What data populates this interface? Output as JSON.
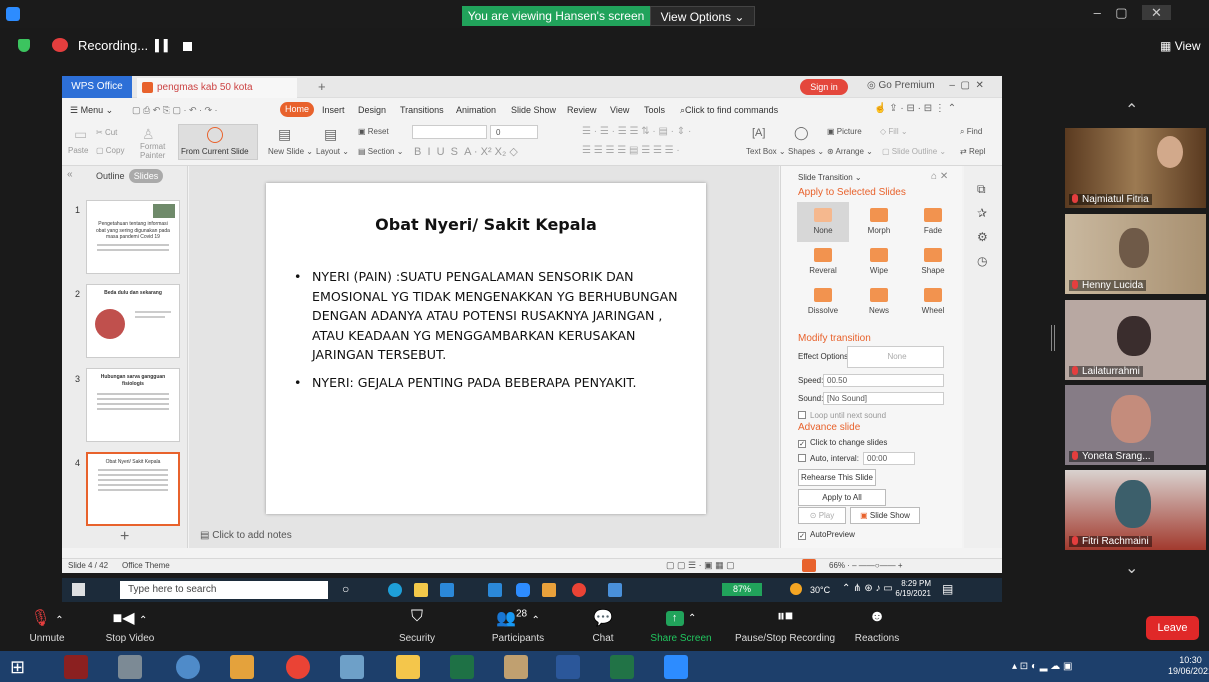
{
  "zoom": {
    "banner": "You are viewing Hansen's screen",
    "view_options": "View Options",
    "recording": "Recording...",
    "view": "View",
    "controls": {
      "unmute": "Unmute",
      "stop_video": "Stop Video",
      "security": "Security",
      "participants": "Participants",
      "participants_count": "28",
      "chat": "Chat",
      "share_screen": "Share Screen",
      "pause_recording": "Pause/Stop Recording",
      "reactions": "Reactions",
      "leave": "Leave"
    },
    "participants": [
      {
        "name": "Najmiatul Fitria",
        "bg": "#6b4a2c"
      },
      {
        "name": "Henny Lucida",
        "bg": "#b8a890"
      },
      {
        "name": "Lailaturrahmi",
        "bg": "#b9a8a0"
      },
      {
        "name": "Yoneta Srang...",
        "bg": "#8a7e88"
      },
      {
        "name": "Fitri Rachmaini",
        "bg": "#a23a2e"
      }
    ]
  },
  "wps": {
    "app": "WPS Office",
    "doc_tab": "pengmas kab 50 kota 2021.pptx",
    "sign_in": "Sign in",
    "go_premium": "Go Premium",
    "menu": [
      "Menu",
      "Home",
      "Insert",
      "Design",
      "Transitions",
      "Animation",
      "Slide Show",
      "Review",
      "View",
      "Tools"
    ],
    "find_commands": "Click to find commands",
    "toolbar": {
      "paste": "Paste",
      "cut": "Cut",
      "copy": "Copy",
      "format_painter": "Format Painter",
      "from_current_slide": "From Current Slide",
      "new_slide": "New Slide",
      "layout": "Layout",
      "reset": "Reset",
      "section": "Section",
      "font_size": "0",
      "text_box": "Text Box",
      "shapes": "Shapes",
      "picture": "Picture",
      "fill": "Fill",
      "arrange": "Arrange",
      "slide_outline": "Slide Outline",
      "find": "Find",
      "replace": "Repl"
    },
    "outline_tab": "Outline",
    "slides_tab": "Slides",
    "thumbnails": [
      {
        "num": "1",
        "title": "Pengetahuan tentang informasi obat yang sering digunakan pada masa pandemi Covid 19"
      },
      {
        "num": "2",
        "title": "Beda dulu dan sekarang"
      },
      {
        "num": "3",
        "title": "Hubungan sarva gangguan fisiologis"
      },
      {
        "num": "4",
        "title": "Obat Nyeri/ Sakit Kepala"
      }
    ],
    "slide": {
      "title": "Obat Nyeri/ Sakit Kepala",
      "bullets": [
        "NYERI (PAIN) :SUATU PENGALAMAN SENSORIK DAN EMOSIONAL YG TIDAK MENGENAKKAN YG BERHUBUNGAN DENGAN ADANYA ATAU POTENSI RUSAKNYA JARINGAN , ATAU KEADAAN YG MENGGAMBARKAN KERUSAKAN JARINGAN TERSEBUT.",
        "NYERI: GEJALA PENTING PADA BEBERAPA PENYAKIT."
      ]
    },
    "notes_placeholder": "Click to add notes",
    "transition_pane": {
      "title": "Slide Transition",
      "apply_to_selected": "Apply to Selected Slides",
      "effects": [
        "None",
        "Morph",
        "Fade",
        "Reveral",
        "Wipe",
        "Shape",
        "Dissolve",
        "News",
        "Wheel"
      ],
      "modify": "Modify transition",
      "effect_options": "Effect Options:",
      "effect_value": "None",
      "speed_label": "Speed:",
      "speed_value": "00.50",
      "sound_label": "Sound:",
      "sound_value": "[No Sound]",
      "loop": "Loop until next sound",
      "advance": "Advance slide",
      "click_change": "Click to change slides",
      "auto_interval": "Auto, interval:",
      "interval_value": "00:00",
      "rehearse": "Rehearse This Slide",
      "apply_all": "Apply to All",
      "play": "Play",
      "slide_show": "Slide Show",
      "autopreview": "AutoPreview"
    },
    "status": {
      "slide_count": "Slide 4 / 42",
      "theme": "Office Theme",
      "zoom": "66%"
    }
  },
  "inner_taskbar": {
    "search": "Type here to search",
    "battery": "87%",
    "weather": "30°C",
    "time": "8:29 PM",
    "date": "6/19/2021"
  },
  "os_taskbar": {
    "time": "10:30",
    "date": "19/06/2021"
  }
}
